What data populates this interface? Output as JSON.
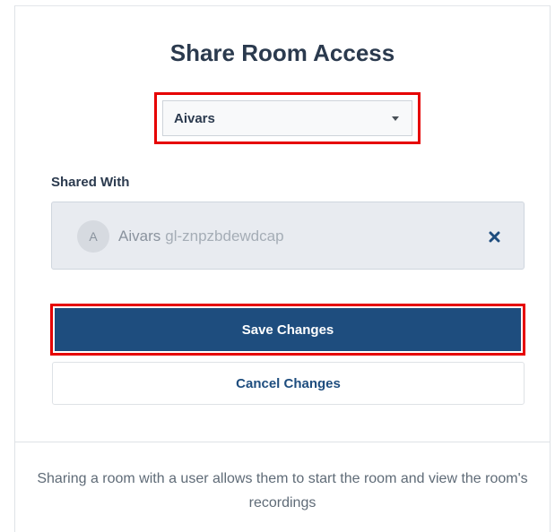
{
  "modal": {
    "title": "Share Room Access"
  },
  "user_select": {
    "selected_value": "Aivars"
  },
  "shared_with": {
    "label": "Shared With",
    "users": [
      {
        "avatar_initial": "A",
        "name": "Aivars",
        "user_id": "gl-znpzbdewdcap",
        "remove_icon": "close-icon"
      }
    ]
  },
  "actions": {
    "save_label": "Save Changes",
    "cancel_label": "Cancel Changes"
  },
  "footer": {
    "text": "Sharing a room with a user allows them to start the room and view the room's recordings"
  },
  "colors": {
    "primary": "#1e4d7e",
    "highlight": "#e60000",
    "shared_bg": "#e8ebf0"
  }
}
